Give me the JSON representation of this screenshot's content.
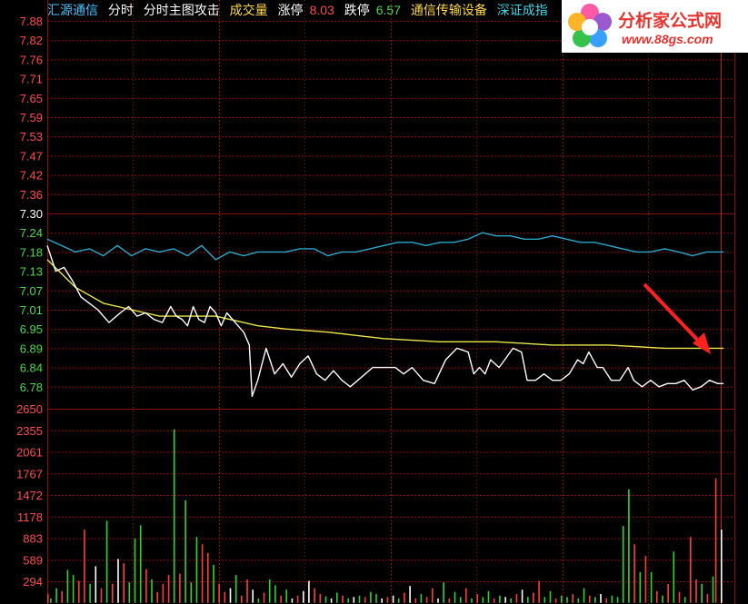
{
  "header": {
    "stock_name": "汇源通信",
    "view_1": "分时",
    "view_2": "分时主图攻击",
    "volume_label": "成交量",
    "limit_up_label": "涨停",
    "limit_up_value": "8.03",
    "limit_down_label": "跌停",
    "limit_down_value": "6.57",
    "sector": "通信传输设备",
    "index_name": "深证成指"
  },
  "logo": {
    "title": "分析家公式网",
    "url": "www.88gs.com"
  },
  "colors": {
    "background": "#000000",
    "grid": "#8a0e0e",
    "up_label": "#ff4b4b",
    "down_label": "#4cd94c",
    "price_line": "#ffffff",
    "avg_line": "#e8e84a",
    "index_line": "#2aa8c8",
    "arrow": "#ff2020"
  },
  "chart_data": [
    {
      "type": "line",
      "name": "price-panel",
      "y_ticks": [
        "7.88",
        "7.82",
        "7.76",
        "7.71",
        "7.65",
        "7.59",
        "7.53",
        "7.47",
        "7.42",
        "7.36",
        "7.30",
        "7.24",
        "7.18",
        "7.13",
        "7.07",
        "7.01",
        "6.95",
        "6.89",
        "6.84",
        "6.78"
      ],
      "prev_close": 7.3,
      "ylim": [
        6.75,
        7.88
      ],
      "n_points": 241,
      "series": [
        {
          "role": "price",
          "points": [
            [
              0,
              7.2
            ],
            [
              3,
              7.13
            ],
            [
              6,
              7.14
            ],
            [
              9,
              7.1
            ],
            [
              12,
              7.05
            ],
            [
              15,
              7.03
            ],
            [
              18,
              7.01
            ],
            [
              22,
              6.97
            ],
            [
              26,
              7.0
            ],
            [
              29,
              7.02
            ],
            [
              32,
              6.99
            ],
            [
              35,
              7.0
            ],
            [
              38,
              6.98
            ],
            [
              41,
              6.97
            ],
            [
              44,
              7.02
            ],
            [
              46,
              6.99
            ],
            [
              48,
              6.98
            ],
            [
              50,
              6.96
            ],
            [
              52,
              7.02
            ],
            [
              54,
              6.98
            ],
            [
              56,
              6.97
            ],
            [
              58,
              7.02
            ],
            [
              60,
              7.0
            ],
            [
              62,
              6.96
            ],
            [
              64,
              7.0
            ],
            [
              66,
              6.98
            ],
            [
              68,
              6.96
            ],
            [
              70,
              6.94
            ],
            [
              72,
              6.9
            ],
            [
              73,
              6.75
            ],
            [
              75,
              6.8
            ],
            [
              78,
              6.89
            ],
            [
              81,
              6.82
            ],
            [
              84,
              6.85
            ],
            [
              87,
              6.81
            ],
            [
              90,
              6.85
            ],
            [
              93,
              6.87
            ],
            [
              96,
              6.82
            ],
            [
              99,
              6.8
            ],
            [
              102,
              6.83
            ],
            [
              105,
              6.8
            ],
            [
              108,
              6.78
            ],
            [
              112,
              6.81
            ],
            [
              116,
              6.84
            ],
            [
              120,
              6.84
            ],
            [
              124,
              6.84
            ],
            [
              127,
              6.82
            ],
            [
              130,
              6.84
            ],
            [
              134,
              6.8
            ],
            [
              138,
              6.79
            ],
            [
              142,
              6.86
            ],
            [
              146,
              6.89
            ],
            [
              150,
              6.88
            ],
            [
              152,
              6.82
            ],
            [
              154,
              6.84
            ],
            [
              156,
              6.82
            ],
            [
              158,
              6.86
            ],
            [
              161,
              6.84
            ],
            [
              163,
              6.86
            ],
            [
              166,
              6.89
            ],
            [
              169,
              6.88
            ],
            [
              171,
              6.8
            ],
            [
              174,
              6.8
            ],
            [
              177,
              6.82
            ],
            [
              180,
              6.8
            ],
            [
              183,
              6.8
            ],
            [
              186,
              6.82
            ],
            [
              189,
              6.86
            ],
            [
              191,
              6.85
            ],
            [
              193,
              6.88
            ],
            [
              196,
              6.84
            ],
            [
              198,
              6.84
            ],
            [
              201,
              6.8
            ],
            [
              204,
              6.8
            ],
            [
              207,
              6.84
            ],
            [
              209,
              6.8
            ],
            [
              212,
              6.78
            ],
            [
              215,
              6.8
            ],
            [
              218,
              6.78
            ],
            [
              221,
              6.79
            ],
            [
              224,
              6.79
            ],
            [
              227,
              6.8
            ],
            [
              230,
              6.77
            ],
            [
              233,
              6.78
            ],
            [
              236,
              6.8
            ],
            [
              239,
              6.79
            ],
            [
              241,
              6.79
            ]
          ]
        },
        {
          "role": "average",
          "points": [
            [
              0,
              7.16
            ],
            [
              10,
              7.08
            ],
            [
              20,
              7.03
            ],
            [
              30,
              7.01
            ],
            [
              40,
              6.99
            ],
            [
              60,
              6.99
            ],
            [
              70,
              6.97
            ],
            [
              75,
              6.96
            ],
            [
              85,
              6.95
            ],
            [
              100,
              6.94
            ],
            [
              120,
              6.92
            ],
            [
              140,
              6.91
            ],
            [
              160,
              6.91
            ],
            [
              180,
              6.9
            ],
            [
              200,
              6.9
            ],
            [
              220,
              6.89
            ],
            [
              241,
              6.89
            ]
          ]
        },
        {
          "role": "index",
          "points": [
            [
              0,
              7.22
            ],
            [
              5,
              7.2
            ],
            [
              10,
              7.18
            ],
            [
              15,
              7.19
            ],
            [
              20,
              7.17
            ],
            [
              25,
              7.2
            ],
            [
              30,
              7.17
            ],
            [
              35,
              7.19
            ],
            [
              40,
              7.18
            ],
            [
              45,
              7.19
            ],
            [
              50,
              7.17
            ],
            [
              55,
              7.2
            ],
            [
              60,
              7.16
            ],
            [
              65,
              7.18
            ],
            [
              70,
              7.17
            ],
            [
              75,
              7.18
            ],
            [
              80,
              7.18
            ],
            [
              85,
              7.18
            ],
            [
              90,
              7.19
            ],
            [
              95,
              7.19
            ],
            [
              100,
              7.17
            ],
            [
              105,
              7.18
            ],
            [
              110,
              7.18
            ],
            [
              115,
              7.19
            ],
            [
              120,
              7.2
            ],
            [
              125,
              7.21
            ],
            [
              130,
              7.21
            ],
            [
              135,
              7.2
            ],
            [
              140,
              7.21
            ],
            [
              145,
              7.21
            ],
            [
              150,
              7.22
            ],
            [
              155,
              7.24
            ],
            [
              160,
              7.23
            ],
            [
              165,
              7.23
            ],
            [
              170,
              7.22
            ],
            [
              175,
              7.22
            ],
            [
              180,
              7.23
            ],
            [
              185,
              7.22
            ],
            [
              190,
              7.21
            ],
            [
              195,
              7.21
            ],
            [
              200,
              7.2
            ],
            [
              205,
              7.19
            ],
            [
              210,
              7.18
            ],
            [
              215,
              7.18
            ],
            [
              220,
              7.19
            ],
            [
              225,
              7.18
            ],
            [
              230,
              7.17
            ],
            [
              235,
              7.18
            ],
            [
              241,
              7.18
            ]
          ]
        }
      ]
    },
    {
      "type": "bar",
      "name": "volume-panel",
      "y_ticks": [
        "2650",
        "2355",
        "2061",
        "1767",
        "1472",
        "1178",
        "883",
        "589",
        "294"
      ],
      "ylim": [
        0,
        2650
      ],
      "bars": [
        [
          0,
          120,
          "r"
        ],
        [
          1,
          60,
          "g"
        ],
        [
          3,
          200,
          "g"
        ],
        [
          5,
          160,
          "r"
        ],
        [
          7,
          450,
          "g"
        ],
        [
          9,
          380,
          "g"
        ],
        [
          11,
          300,
          "r"
        ],
        [
          13,
          1000,
          "r"
        ],
        [
          15,
          260,
          "g"
        ],
        [
          17,
          500,
          "w"
        ],
        [
          19,
          200,
          "r"
        ],
        [
          21,
          1120,
          "g"
        ],
        [
          23,
          260,
          "r"
        ],
        [
          25,
          600,
          "w"
        ],
        [
          27,
          540,
          "r"
        ],
        [
          29,
          280,
          "g"
        ],
        [
          31,
          880,
          "g"
        ],
        [
          33,
          1060,
          "g"
        ],
        [
          35,
          460,
          "r"
        ],
        [
          37,
          320,
          "g"
        ],
        [
          39,
          150,
          "r"
        ],
        [
          41,
          260,
          "r"
        ],
        [
          43,
          380,
          "r"
        ],
        [
          45,
          2370,
          "g"
        ],
        [
          47,
          400,
          "r"
        ],
        [
          49,
          1400,
          "g"
        ],
        [
          51,
          280,
          "g"
        ],
        [
          53,
          900,
          "g"
        ],
        [
          55,
          800,
          "r"
        ],
        [
          57,
          680,
          "r"
        ],
        [
          59,
          520,
          "g"
        ],
        [
          61,
          260,
          "r"
        ],
        [
          63,
          150,
          "r"
        ],
        [
          65,
          200,
          "w"
        ],
        [
          67,
          380,
          "g"
        ],
        [
          69,
          100,
          "r"
        ],
        [
          71,
          320,
          "r"
        ],
        [
          73,
          180,
          "w"
        ],
        [
          75,
          60,
          "g"
        ],
        [
          77,
          140,
          "r"
        ],
        [
          79,
          320,
          "g"
        ],
        [
          81,
          240,
          "g"
        ],
        [
          83,
          100,
          "r"
        ],
        [
          85,
          180,
          "g"
        ],
        [
          87,
          60,
          "w"
        ],
        [
          89,
          100,
          "r"
        ],
        [
          91,
          160,
          "w"
        ],
        [
          93,
          300,
          "w"
        ],
        [
          95,
          200,
          "r"
        ],
        [
          97,
          120,
          "r"
        ],
        [
          99,
          90,
          "g"
        ],
        [
          101,
          60,
          "w"
        ],
        [
          103,
          140,
          "g"
        ],
        [
          105,
          100,
          "r"
        ],
        [
          107,
          60,
          "g"
        ],
        [
          109,
          80,
          "w"
        ],
        [
          111,
          100,
          "g"
        ],
        [
          113,
          80,
          "r"
        ],
        [
          115,
          150,
          "g"
        ],
        [
          117,
          120,
          "g"
        ],
        [
          119,
          60,
          "w"
        ],
        [
          121,
          80,
          "r"
        ],
        [
          123,
          100,
          "w"
        ],
        [
          125,
          60,
          "g"
        ],
        [
          127,
          140,
          "r"
        ],
        [
          129,
          230,
          "w"
        ],
        [
          131,
          60,
          "r"
        ],
        [
          133,
          120,
          "g"
        ],
        [
          135,
          80,
          "r"
        ],
        [
          137,
          200,
          "r"
        ],
        [
          139,
          60,
          "w"
        ],
        [
          141,
          280,
          "g"
        ],
        [
          143,
          60,
          "r"
        ],
        [
          145,
          150,
          "g"
        ],
        [
          147,
          80,
          "g"
        ],
        [
          149,
          200,
          "r"
        ],
        [
          151,
          60,
          "g"
        ],
        [
          153,
          120,
          "r"
        ],
        [
          155,
          80,
          "g"
        ],
        [
          157,
          160,
          "g"
        ],
        [
          159,
          60,
          "r"
        ],
        [
          161,
          100,
          "g"
        ],
        [
          163,
          80,
          "w"
        ],
        [
          165,
          60,
          "g"
        ],
        [
          167,
          120,
          "r"
        ],
        [
          169,
          180,
          "w"
        ],
        [
          171,
          80,
          "g"
        ],
        [
          173,
          140,
          "r"
        ],
        [
          175,
          300,
          "r"
        ],
        [
          177,
          80,
          "g"
        ],
        [
          179,
          160,
          "g"
        ],
        [
          181,
          60,
          "r"
        ],
        [
          183,
          100,
          "g"
        ],
        [
          185,
          80,
          "g"
        ],
        [
          187,
          120,
          "r"
        ],
        [
          189,
          60,
          "g"
        ],
        [
          191,
          200,
          "g"
        ],
        [
          193,
          100,
          "r"
        ],
        [
          195,
          80,
          "g"
        ],
        [
          197,
          120,
          "w"
        ],
        [
          199,
          60,
          "r"
        ],
        [
          201,
          100,
          "g"
        ],
        [
          203,
          80,
          "g"
        ],
        [
          205,
          1050,
          "g"
        ],
        [
          207,
          1550,
          "g"
        ],
        [
          209,
          800,
          "r"
        ],
        [
          211,
          420,
          "g"
        ],
        [
          213,
          640,
          "r"
        ],
        [
          215,
          420,
          "g"
        ],
        [
          217,
          160,
          "r"
        ],
        [
          219,
          100,
          "g"
        ],
        [
          221,
          260,
          "r"
        ],
        [
          223,
          700,
          "g"
        ],
        [
          225,
          150,
          "r"
        ],
        [
          227,
          80,
          "g"
        ],
        [
          229,
          900,
          "r"
        ],
        [
          231,
          320,
          "r"
        ],
        [
          233,
          260,
          "g"
        ],
        [
          235,
          120,
          "r"
        ],
        [
          237,
          360,
          "g"
        ],
        [
          238,
          1700,
          "r"
        ],
        [
          240,
          1000,
          "w"
        ]
      ]
    }
  ]
}
